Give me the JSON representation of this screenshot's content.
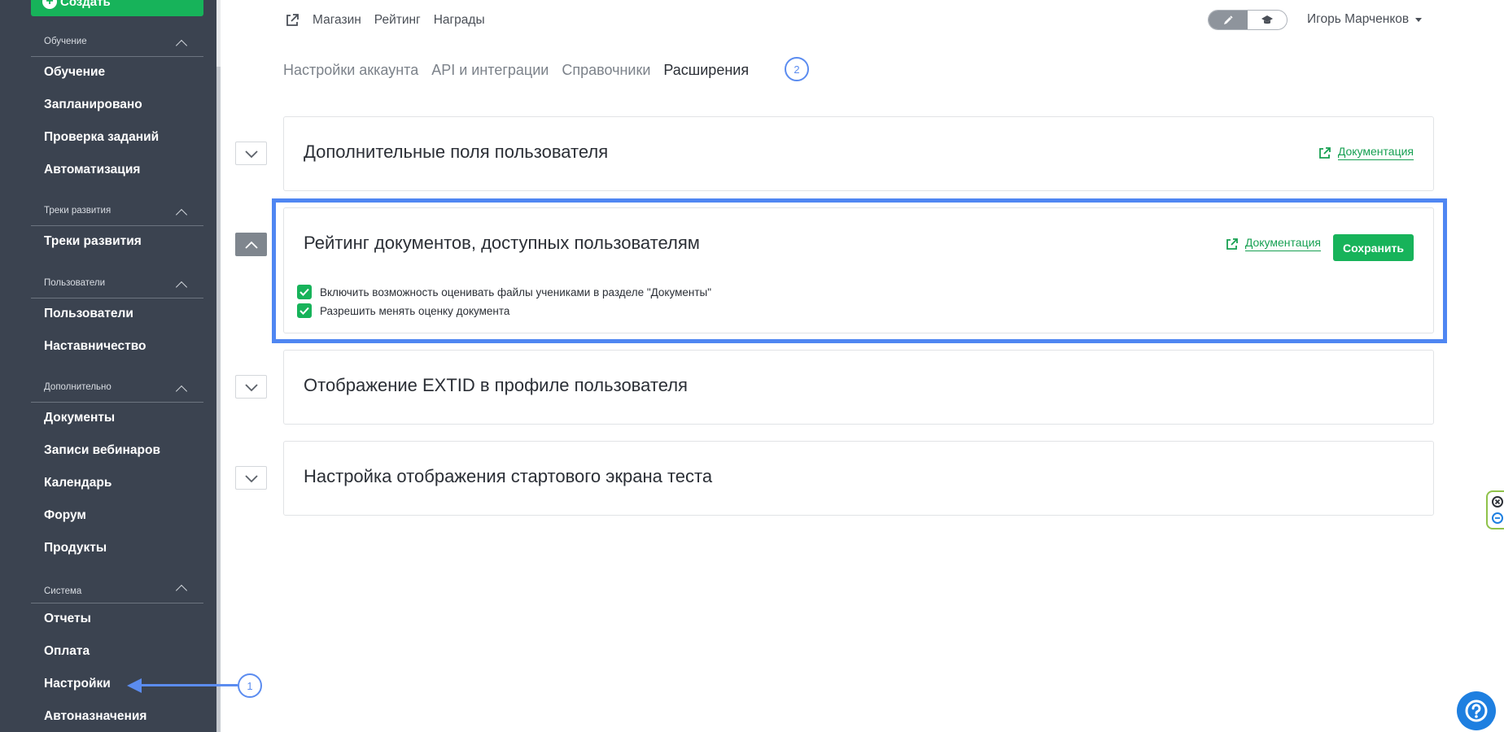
{
  "sidebar": {
    "create_label": "Создать",
    "sections": [
      {
        "title": "Обучение",
        "items": [
          "Обучение",
          "Запланировано",
          "Проверка заданий",
          "Автоматизация"
        ]
      },
      {
        "title": "Треки развития",
        "items": [
          "Треки развития"
        ]
      },
      {
        "title": "Пользователи",
        "items": [
          "Пользователи",
          "Наставничество"
        ]
      },
      {
        "title": "Дополнительно",
        "items": [
          "Документы",
          "Записи вебинаров",
          "Календарь",
          "Форум",
          "Продукты"
        ]
      },
      {
        "title": "Система",
        "items": [
          "Отчеты",
          "Оплата",
          "Настройки",
          "Автоназначения"
        ]
      }
    ]
  },
  "topbar": {
    "links": [
      "Магазин",
      "Рейтинг",
      "Награды"
    ],
    "user_name": "Игорь Марченков",
    "mode_toggle": {
      "icons": [
        "pencil-icon",
        "graduation-cap-icon"
      ],
      "active": 0
    }
  },
  "tabs": [
    {
      "label": "Настройки аккаунта",
      "active": false
    },
    {
      "label": "API и интеграции",
      "active": false
    },
    {
      "label": "Справочники",
      "active": false
    },
    {
      "label": "Расширения",
      "active": true
    }
  ],
  "annotations": {
    "step1": "1",
    "step2": "2"
  },
  "panels": [
    {
      "title": "Дополнительные поля пользователя",
      "doc_link": "Документация",
      "expanded": false
    },
    {
      "title": "Рейтинг документов, доступных пользователям",
      "doc_link": "Документация",
      "save_label": "Сохранить",
      "expanded": true,
      "options": [
        {
          "label": "Включить возможность оценивать файлы учениками в разделе \"Документы\"",
          "checked": true
        },
        {
          "label": "Разрешить менять оценку документа",
          "checked": true
        }
      ]
    },
    {
      "title": "Отображение EXTID в профиле пользователя",
      "expanded": false
    },
    {
      "title": "Настройка отображения стартового экрана теста",
      "expanded": false
    }
  ],
  "colors": {
    "sidebar_bg": "#3b4350",
    "accent_green": "#17b35a",
    "annotation_blue": "#4f86f2",
    "help_blue": "#1e7fe0"
  }
}
